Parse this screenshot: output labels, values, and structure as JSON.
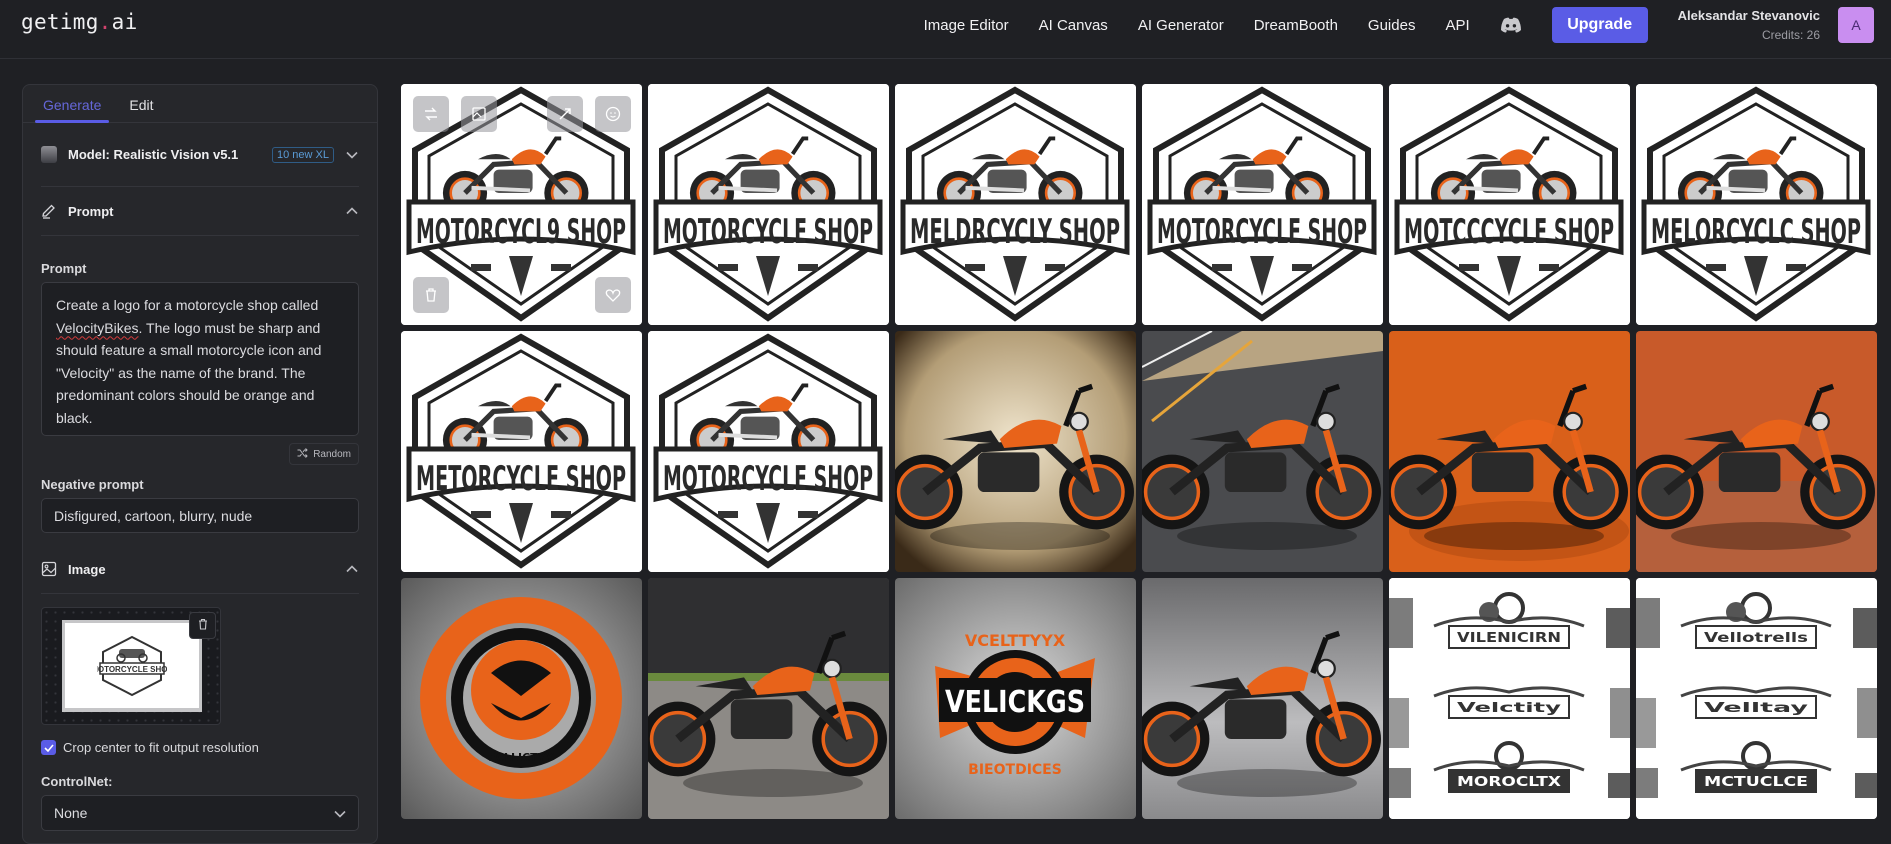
{
  "app": {
    "logo_main": "getimg",
    "logo_dot": ".",
    "logo_tld": "ai"
  },
  "nav": {
    "links": [
      "Image Editor",
      "AI Canvas",
      "AI Generator",
      "DreamBooth",
      "Guides",
      "API"
    ],
    "discord_icon": "discord-icon",
    "upgrade_label": "Upgrade",
    "user_name": "Aleksandar Stevanovic",
    "credits": "Credits: 26",
    "avatar_initial": "A"
  },
  "panel": {
    "tabs": [
      {
        "label": "Generate",
        "active": true
      },
      {
        "label": "Edit",
        "active": false
      }
    ],
    "model_label": "Model: Realistic Vision v5.1",
    "model_badge": "10 new XL",
    "prompt_section": "Prompt",
    "prompt_label": "Prompt",
    "prompt_text_before": "Create a logo for a motorcycle shop called ",
    "prompt_text_misspelled": "VelocityBikes",
    "prompt_text_after": ". The logo must be sharp and should feature a small motorcycle icon and \"Velocity\" as the name of the brand. The predominant colors should be orange and black.",
    "random_label": "Random",
    "negative_label": "Negative prompt",
    "negative_value": "Disfigured, cartoon, blurry, nude",
    "image_section": "Image",
    "preview_text": "MOTORCYCLE SHOP",
    "crop_label": "Crop center to fit output resolution",
    "crop_checked": true,
    "controlnet_label": "ControlNet:",
    "controlnet_value": "None"
  },
  "colors": {
    "accent": "#5a5ce6",
    "avatar_bg": "#c98ef0",
    "logo_dot": "#d1436e",
    "orange": "#e8631a"
  },
  "gallery": {
    "images": [
      {
        "kind": "hex-logo",
        "text": "MOTORCYCL9 SHOP",
        "hovered": true
      },
      {
        "kind": "hex-logo",
        "text": "MOTORCYCLE SHOP"
      },
      {
        "kind": "hex-logo",
        "text": "MELDRCYCLY SHOP"
      },
      {
        "kind": "hex-logo",
        "text": "MOTORCYCLE SHOP"
      },
      {
        "kind": "hex-logo",
        "text": "MOTCCCYCLE SHOP"
      },
      {
        "kind": "hex-logo",
        "text": "MELORCYCLC SHOP"
      },
      {
        "kind": "hex-logo",
        "text": "METORCYCLE SHOP"
      },
      {
        "kind": "hex-logo",
        "text": "MOTORCYCLE SHOP"
      },
      {
        "kind": "photo-bike",
        "bg": "sepia"
      },
      {
        "kind": "photo-bike",
        "bg": "road"
      },
      {
        "kind": "photo-bike",
        "bg": "orange"
      },
      {
        "kind": "photo-bike",
        "bg": "rust"
      },
      {
        "kind": "round-logo",
        "text": "ECLLICTYY"
      },
      {
        "kind": "photo-bike",
        "bg": "street"
      },
      {
        "kind": "badge-logo",
        "text": "VELICKGS",
        "top": "VCELTTYYX",
        "bottom": "BIEOTDICES"
      },
      {
        "kind": "photo-bike",
        "bg": "studio"
      },
      {
        "kind": "sheet-logo",
        "texts": [
          "VILENICIRN",
          "Velctity",
          "MOROCLTX"
        ]
      },
      {
        "kind": "sheet-logo",
        "texts": [
          "Vellotrells",
          "Velltay",
          "MCTUCLCE"
        ]
      }
    ],
    "overlay_buttons": [
      "regenerate-icon",
      "image-to-image-icon",
      "upscale-icon",
      "face-fix-icon",
      "delete-icon",
      "favorite-icon"
    ]
  }
}
